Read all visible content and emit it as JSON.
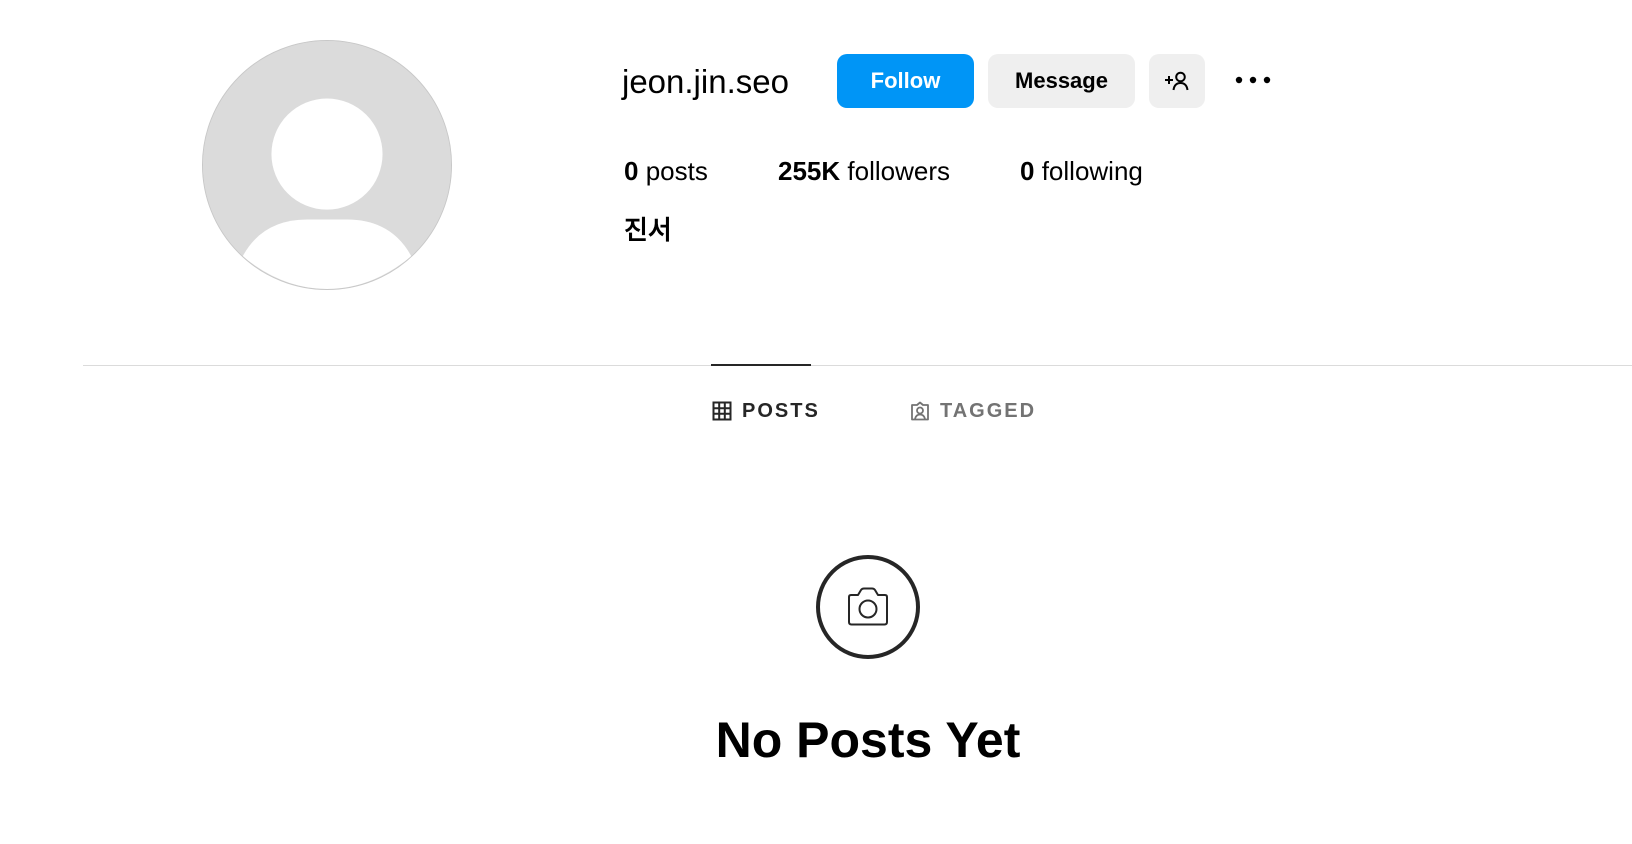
{
  "profile": {
    "username": "jeon.jin.seo",
    "full_name": "진서",
    "avatar_icon": "default-avatar-icon"
  },
  "actions": {
    "follow_label": "Follow",
    "message_label": "Message",
    "suggest_icon": "add-person-icon",
    "more_icon": "more-options-icon"
  },
  "stats": {
    "posts": {
      "count": "0",
      "label": "posts"
    },
    "followers": {
      "count": "255K",
      "label": "followers"
    },
    "following": {
      "count": "0",
      "label": "following"
    }
  },
  "tabs": [
    {
      "label": "POSTS",
      "icon": "grid-icon",
      "active": true
    },
    {
      "label": "TAGGED",
      "icon": "tagged-person-icon",
      "active": false
    }
  ],
  "empty_state": {
    "icon": "camera-icon",
    "title": "No Posts Yet"
  },
  "colors": {
    "follow_button": "#0095f6",
    "secondary_button": "#efefef",
    "avatar_bg": "#dbdbdb",
    "divider": "#dbdbdb",
    "inactive_tab": "#737373"
  }
}
